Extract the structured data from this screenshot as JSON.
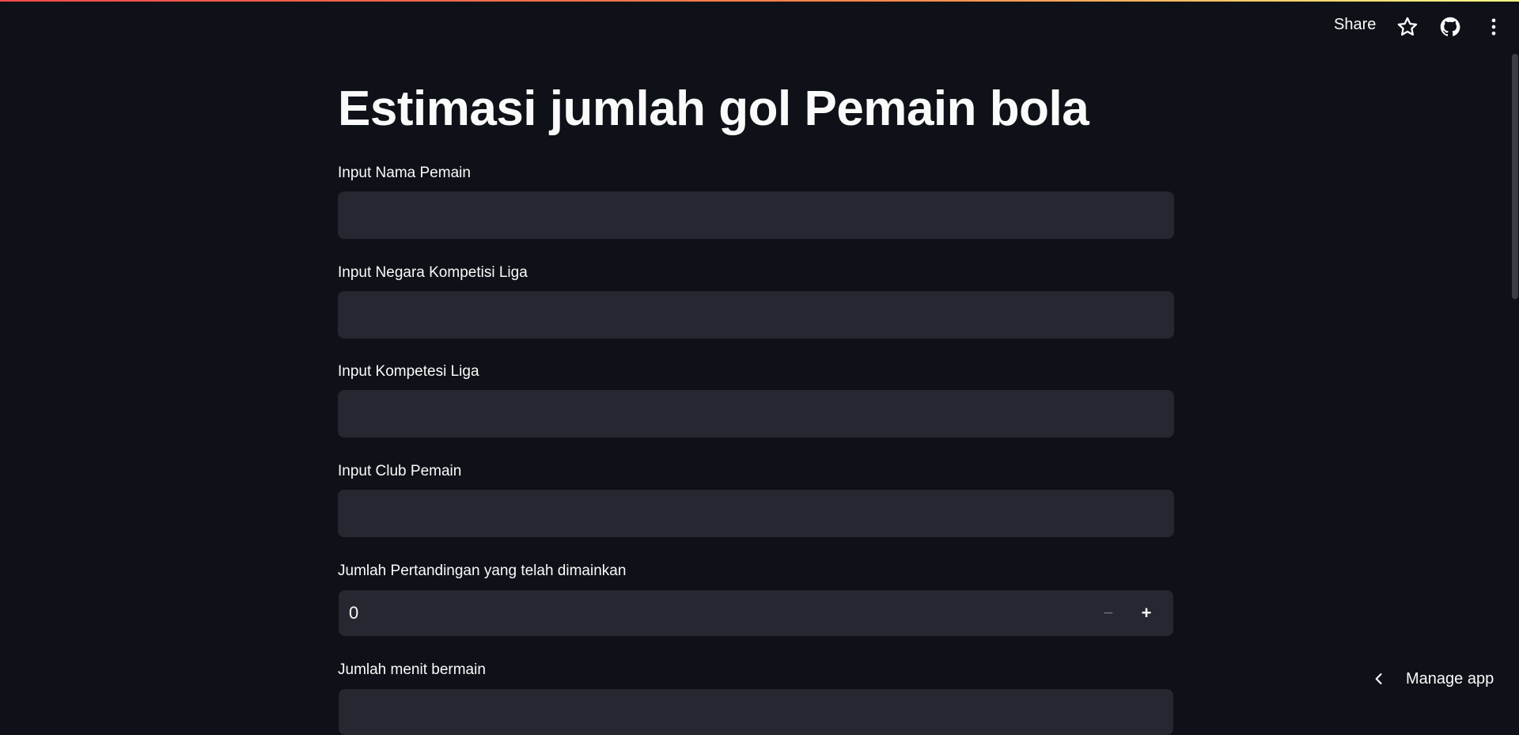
{
  "header": {
    "share_label": "Share",
    "icons": [
      "star-icon",
      "github-icon",
      "more-vertical-icon"
    ]
  },
  "main": {
    "title": "Estimasi jumlah gol Pemain bola",
    "fields": [
      {
        "label": "Input Nama Pemain",
        "value": "",
        "type": "text"
      },
      {
        "label": "Input Negara Kompetisi Liga",
        "value": "",
        "type": "text"
      },
      {
        "label": "Input Kompetesi Liga",
        "value": "",
        "type": "text"
      },
      {
        "label": "Input Club Pemain",
        "value": "",
        "type": "text"
      },
      {
        "label": "Jumlah Pertandingan yang telah dimainkan",
        "value": "0",
        "type": "number",
        "minus": "−",
        "plus": "+"
      },
      {
        "label": "Jumlah menit bermain",
        "value": "",
        "type": "number"
      }
    ]
  },
  "footer": {
    "manage_app_label": "Manage app"
  },
  "colors": {
    "background": "#0e1117",
    "input_bg": "#262730",
    "text": "#fafafa",
    "accent_gradient_start": "#ff4b4b",
    "accent_gradient_end": "#fffd80"
  }
}
